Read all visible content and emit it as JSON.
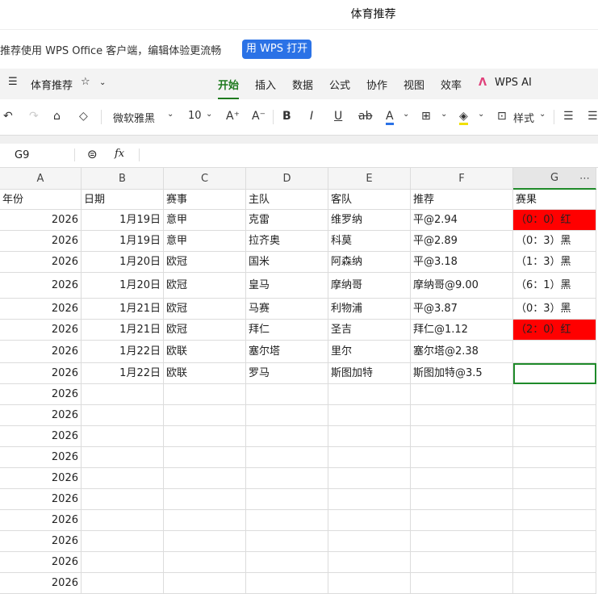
{
  "window": {
    "title": "体育推荐"
  },
  "banner": {
    "text": "推荐使用 WPS Office 客户端，编辑体验更流畅",
    "button": "用 WPS 打开"
  },
  "ribbon": {
    "doc_name": "体育推荐",
    "tabs": [
      "开始",
      "插入",
      "数据",
      "公式",
      "协作",
      "视图",
      "效率",
      "WPS AI"
    ],
    "active_tab": "开始"
  },
  "toolbar": {
    "font": "微软雅黑",
    "font_size": "10",
    "style_label": "样式"
  },
  "formula_bar": {
    "cell_ref": "G9",
    "fx": "fx",
    "value": ""
  },
  "sheet": {
    "columns": [
      "A",
      "B",
      "C",
      "D",
      "E",
      "F",
      "G"
    ],
    "header_row": [
      "年份",
      "日期",
      "赛事",
      "主队",
      "客队",
      "推荐",
      "赛果"
    ],
    "rows": [
      [
        "2026",
        "1月19日",
        "意甲",
        "克雷",
        "维罗纳",
        "平@2.94",
        "（0：0）红"
      ],
      [
        "2026",
        "1月19日",
        "意甲",
        "拉齐奥",
        "科莫",
        "平@2.89",
        "（0：3）黑"
      ],
      [
        "2026",
        "1月20日",
        "欧冠",
        "国米",
        "阿森纳",
        "平@3.18",
        "（1：3）黑"
      ],
      [
        "2026",
        "1月20日",
        "欧冠",
        "皇马",
        "摩纳哥",
        "摩纳哥@9.00",
        "（6：1）黑"
      ],
      [
        "2026",
        "1月21日",
        "欧冠",
        "马赛",
        "利物浦",
        "平@3.87",
        "（0：3）黑"
      ],
      [
        "2026",
        "1月21日",
        "欧冠",
        "拜仁",
        "圣吉",
        "拜仁@1.12",
        "（2：0）红"
      ],
      [
        "2026",
        "1月22日",
        "欧联",
        "塞尔塔",
        "里尔",
        "塞尔塔@2.38",
        ""
      ],
      [
        "2026",
        "1月22日",
        "欧联",
        "罗马",
        "斯图加特",
        "斯图加特@3.5",
        ""
      ],
      [
        "2026",
        "",
        "",
        "",
        "",
        "",
        ""
      ],
      [
        "2026",
        "",
        "",
        "",
        "",
        "",
        ""
      ],
      [
        "2026",
        "",
        "",
        "",
        "",
        "",
        ""
      ],
      [
        "2026",
        "",
        "",
        "",
        "",
        "",
        ""
      ],
      [
        "2026",
        "",
        "",
        "",
        "",
        "",
        ""
      ],
      [
        "2026",
        "",
        "",
        "",
        "",
        "",
        ""
      ],
      [
        "2026",
        "",
        "",
        "",
        "",
        "",
        ""
      ],
      [
        "2026",
        "",
        "",
        "",
        "",
        "",
        ""
      ],
      [
        "2026",
        "",
        "",
        "",
        "",
        "",
        ""
      ],
      [
        "2026",
        "",
        "",
        "",
        "",
        "",
        ""
      ]
    ],
    "highlight_color": "#ff0000",
    "selected_cell": "G9"
  }
}
